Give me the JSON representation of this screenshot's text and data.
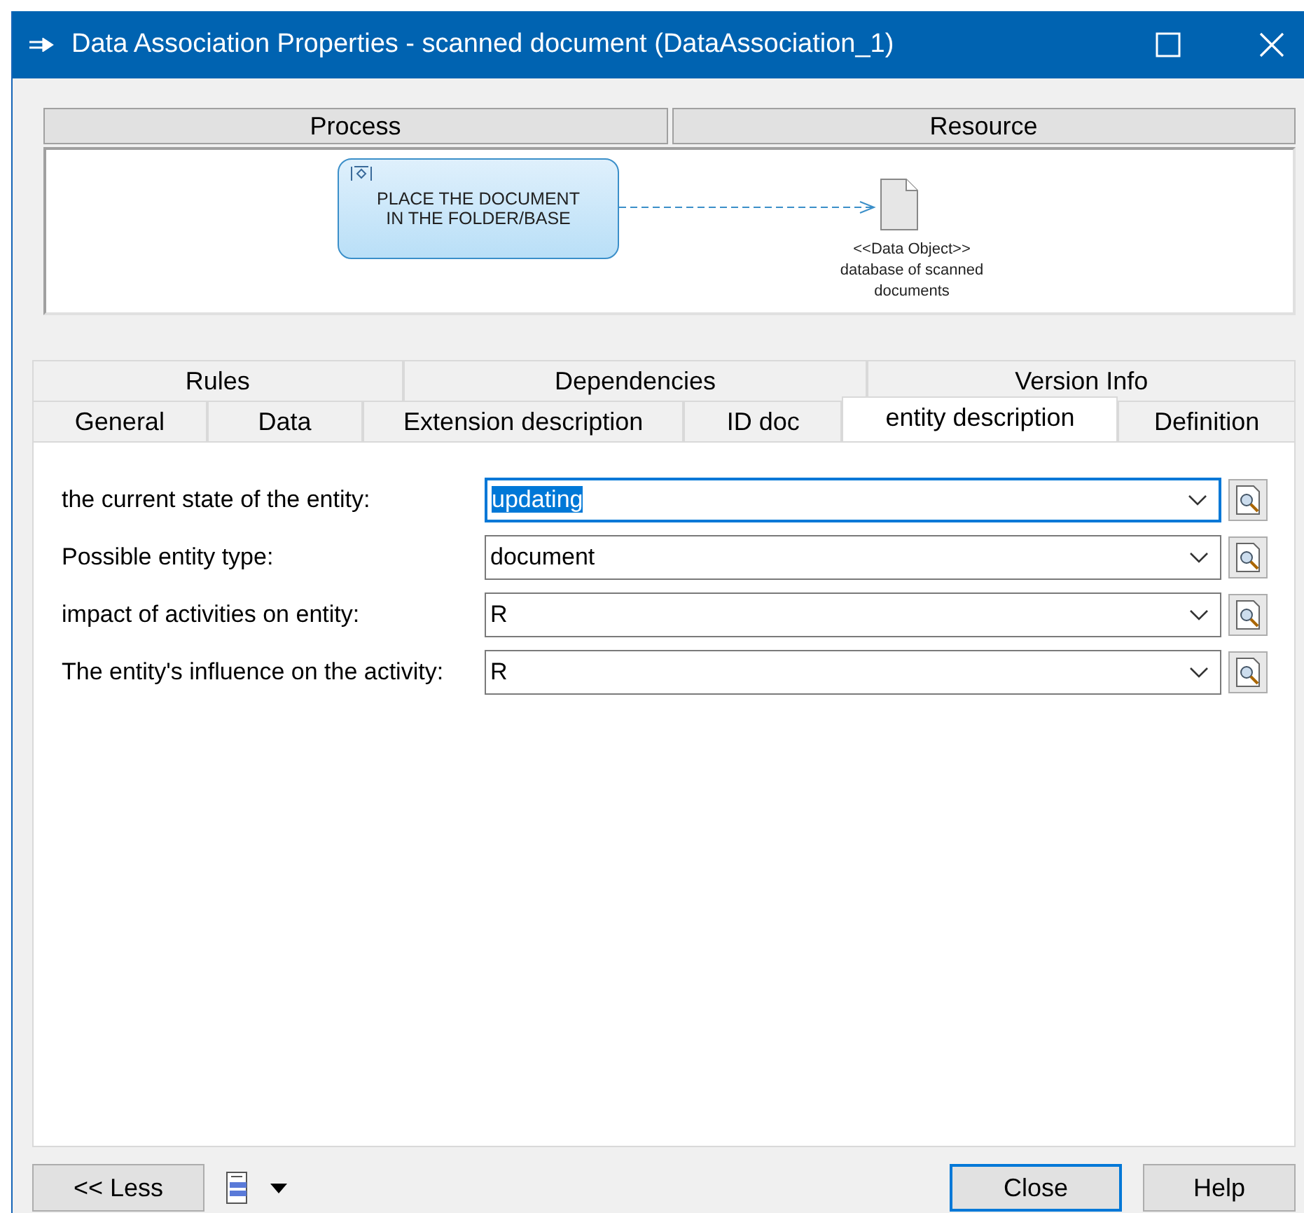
{
  "window": {
    "title": "Data Association Properties - scanned document (DataAssociation_1)"
  },
  "diagram": {
    "headers": [
      "Process",
      "Resource"
    ],
    "process_node": {
      "lines": [
        "PLACE THE DOCUMENT",
        "IN THE FOLDER/BASE"
      ]
    },
    "data_object": {
      "lines": [
        "<<Data Object>>",
        "database of scanned",
        "documents"
      ]
    }
  },
  "tab_rows": [
    [
      {
        "label": "Rules",
        "selected": false
      },
      {
        "label": "Dependencies",
        "selected": false
      },
      {
        "label": "Version Info",
        "selected": false
      }
    ],
    [
      {
        "label": "General",
        "selected": false
      },
      {
        "label": "Data",
        "selected": false
      },
      {
        "label": "Extension description",
        "selected": false
      },
      {
        "label": "ID doc",
        "selected": false
      },
      {
        "label": "entity description",
        "selected": true
      },
      {
        "label": "Definition",
        "selected": false
      }
    ]
  ],
  "fields": [
    {
      "label": "the current state of the entity:",
      "value": "updating",
      "selected": true
    },
    {
      "label": "Possible entity type:",
      "value": "document",
      "selected": false
    },
    {
      "label": "impact of activities on entity:",
      "value": "R",
      "selected": false
    },
    {
      "label": "The entity's influence on the activity:",
      "value": "R",
      "selected": false
    }
  ],
  "buttons": {
    "less": "<< Less",
    "close": "Close",
    "help": "Help"
  }
}
